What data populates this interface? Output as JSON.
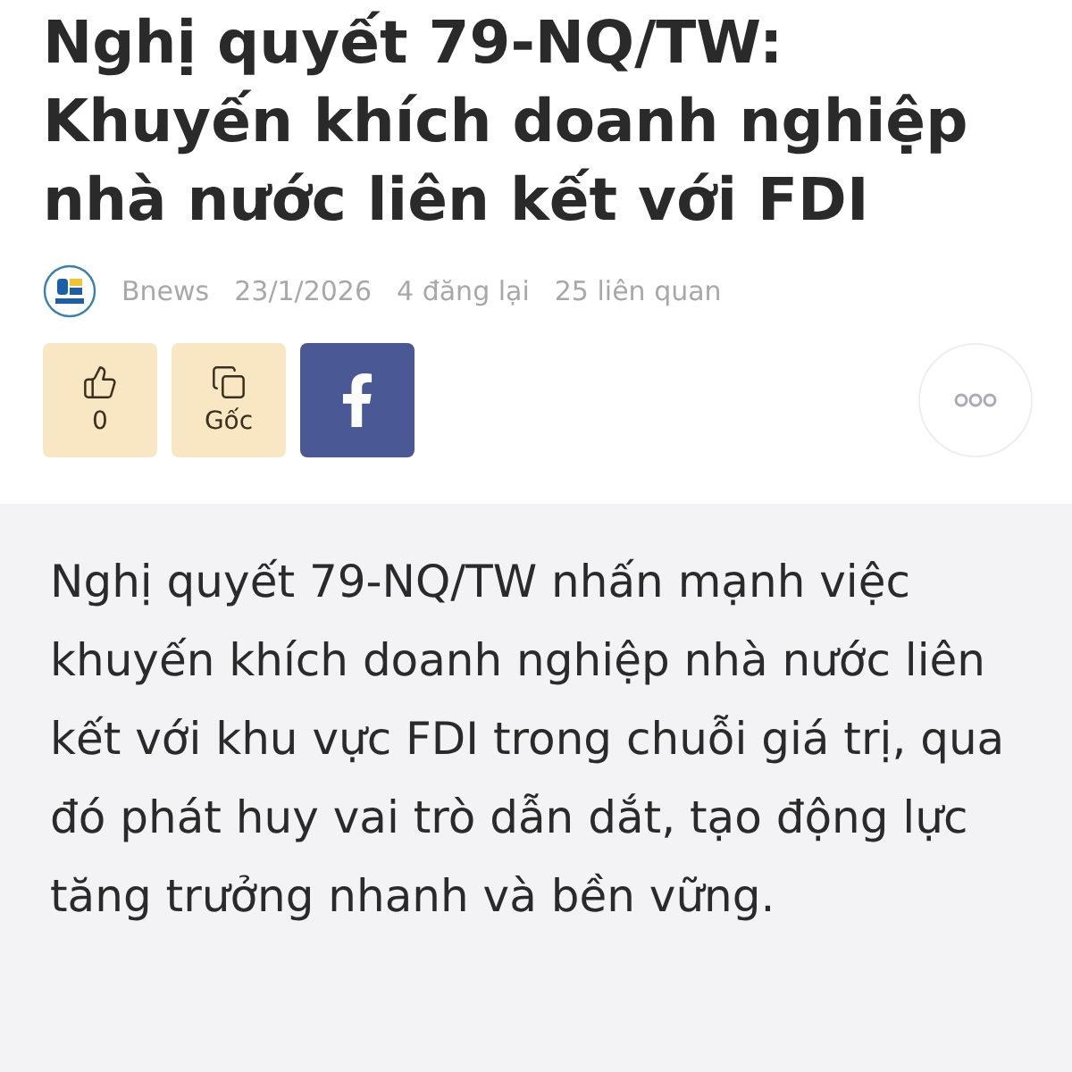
{
  "title": "Nghị quyết 79-NQ/TW: Khuyến khích doanh nghiệp nhà nước liên kết với FDI",
  "meta": {
    "source": "Bnews",
    "date": "23/1/2026",
    "reposts": "4 đăng lại",
    "related": "25 liên quan"
  },
  "actions": [
    {
      "kind": "like",
      "label": "0"
    },
    {
      "kind": "original",
      "label": "Gốc"
    },
    {
      "kind": "facebook"
    }
  ],
  "summary": "Nghị quyết 79-NQ/TW nhấn mạnh việc khuyến khích doanh nghiệp nhà nước liên kết với khu vực FDI trong chuỗi giá trị, qua đó phát huy vai trò dẫn dắt, tạo động lực tăng trưởng nhanh và bền vững."
}
